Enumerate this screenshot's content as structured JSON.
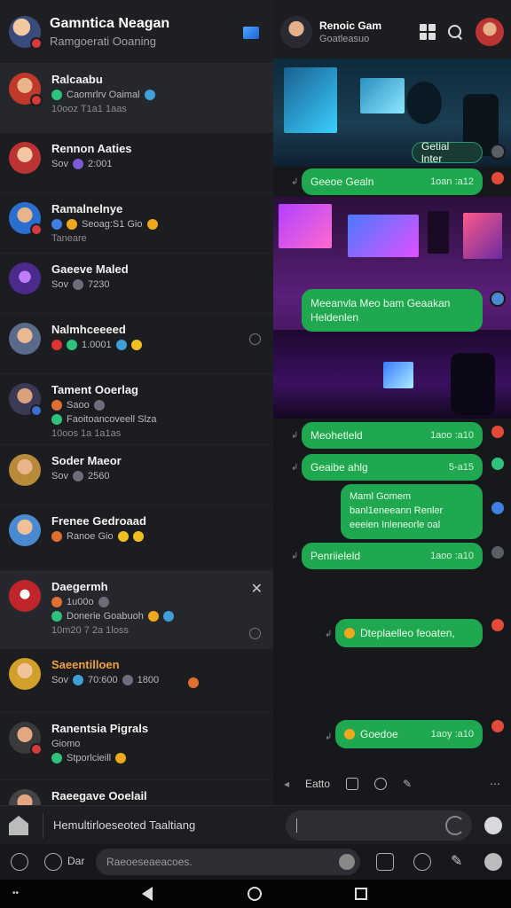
{
  "left_header": {
    "title": "Gamntica Neagan",
    "subtitle": "Ramgoerati Ooaning"
  },
  "chats": [
    {
      "name": "Ralcaabu",
      "line": "Caomrlrv Oaimal",
      "meta": "10ooz T1a1 1aas",
      "prefix": ""
    },
    {
      "name": "Rennon Aaties",
      "line": "2:001",
      "meta": "",
      "prefix": "Sov"
    },
    {
      "name": "Ramalnelnye",
      "line": "Seoag:S1 Gio",
      "meta": "Taneare",
      "prefix": ""
    },
    {
      "name": "Gaeeve Maled",
      "line": "7230",
      "meta": "",
      "prefix": "Sov"
    },
    {
      "name": "Nalmhceeeed",
      "line": "1.0001",
      "meta": "",
      "prefix": ""
    },
    {
      "name": "Tament Ooerlag",
      "line": "Saoo",
      "meta": "10oos 1a 1a1as",
      "prefix": "",
      "line2": "Faoitoancoveell  Slza"
    },
    {
      "name": "Soder Maeor",
      "line": "2560",
      "meta": "",
      "prefix": "Sov"
    },
    {
      "name": "Frenee Gedroaad",
      "line": "Ranoe Gio",
      "meta": "",
      "prefix": ""
    },
    {
      "name": "Daegermh",
      "line": "1u00o",
      "meta": "10m20 7 2a 1loss",
      "prefix": "",
      "line2": "Donerie Goabuoh"
    },
    {
      "name": "Saeentilloen",
      "line": "70:600",
      "meta": "",
      "prefix": "Sov",
      "extra": "1800"
    },
    {
      "name": "Ranentsia Pigrals",
      "line": "Stporlcieill",
      "meta": "",
      "prefix": "Giomo"
    },
    {
      "name": "Raeegave Ooelail",
      "line": "",
      "meta": "",
      "prefix": ""
    }
  ],
  "right_header": {
    "title": "Renoic Gam",
    "subtitle": "Goatleasuo"
  },
  "messages": [
    {
      "text": "Getial lnter",
      "time": ""
    },
    {
      "text": "Geeoe Gealn",
      "time": "1oan :a12"
    },
    {
      "text": "Meeanvla Meo bam Geaakan Heldenlen",
      "time": ""
    },
    {
      "text": "Meohetleld",
      "time": "1aoo :a10"
    },
    {
      "text": "Geaibe ahlg",
      "time": "5-a15"
    },
    {
      "text": "Maml Gomem banl1eneeann Renler eeeien Inleneorle oal",
      "time": ""
    },
    {
      "text": "Penriieleld",
      "time": "1aoo :a10"
    },
    {
      "text": "Dteplaelleo feoaten,",
      "time": ""
    },
    {
      "text": "Goedoe",
      "time": "1aoy :a10"
    }
  ],
  "right_toolbar": {
    "label": "Eatto"
  },
  "composer": {
    "label": "Hemultirloeseoted Taaltiang"
  },
  "bottom_bar": {
    "label": "Dar",
    "search_placeholder": "Raeoeseaeacoes."
  }
}
